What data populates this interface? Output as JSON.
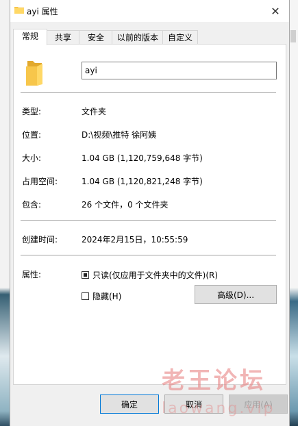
{
  "window": {
    "title": "ayi 属性",
    "close_glyph": "✕"
  },
  "tabs": [
    {
      "label": "常规",
      "active": true
    },
    {
      "label": "共享",
      "active": false
    },
    {
      "label": "安全",
      "active": false
    },
    {
      "label": "以前的版本",
      "active": false
    },
    {
      "label": "自定义",
      "active": false
    }
  ],
  "general": {
    "folder_name": "ayi",
    "type_label": "类型:",
    "type_value": "文件夹",
    "location_label": "位置:",
    "location_value": "D:\\视频\\推特 徐阿姨",
    "size_label": "大小:",
    "size_value": "1.04 GB (1,120,759,648 字节)",
    "size_on_disk_label": "占用空间:",
    "size_on_disk_value": "1.04 GB (1,120,821,248 字节)",
    "contains_label": "包含:",
    "contains_value": "26 个文件，0 个文件夹",
    "created_label": "创建时间:",
    "created_value": "2024年2月15日，10:55:59",
    "attributes_label": "属性:",
    "readonly_label": "只读(仅应用于文件夹中的文件)(R)",
    "readonly_state": "indeterminate",
    "hidden_label": "隐藏(H)",
    "hidden_checked": false,
    "advanced_button": "高级(D)..."
  },
  "footer": {
    "ok": "确定",
    "cancel": "取消",
    "apply": "应用(A)"
  },
  "watermark": {
    "text": "老王论坛",
    "subtext": "laowang.vip"
  },
  "icons": {
    "folder": "folder-icon",
    "close": "close-icon"
  },
  "colors": {
    "folder": "#f7c64b",
    "accent": "#0078d7"
  }
}
